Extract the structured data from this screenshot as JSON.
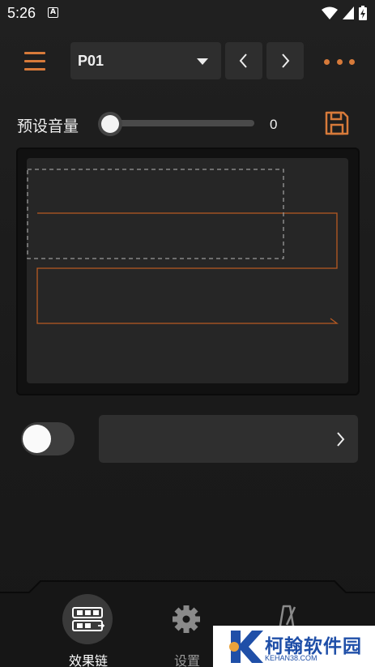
{
  "status_bar": {
    "time": "5:26",
    "notification_letter": "A"
  },
  "header": {
    "preset_value": "P01"
  },
  "volume": {
    "label": "预设音量",
    "value": "0",
    "level": 0
  },
  "bottom_nav": [
    {
      "label": "效果链",
      "active": true
    },
    {
      "label": "设置",
      "active": false
    },
    {
      "label": "",
      "active": false
    }
  ],
  "watermark": {
    "text": "柯翰软件园",
    "sub": "KEHAN38.COM"
  },
  "colors": {
    "accent": "#d77a3a",
    "background": "#1c1c1c",
    "panel": "#2e2e2e",
    "watermark": "#1f4fa8"
  }
}
